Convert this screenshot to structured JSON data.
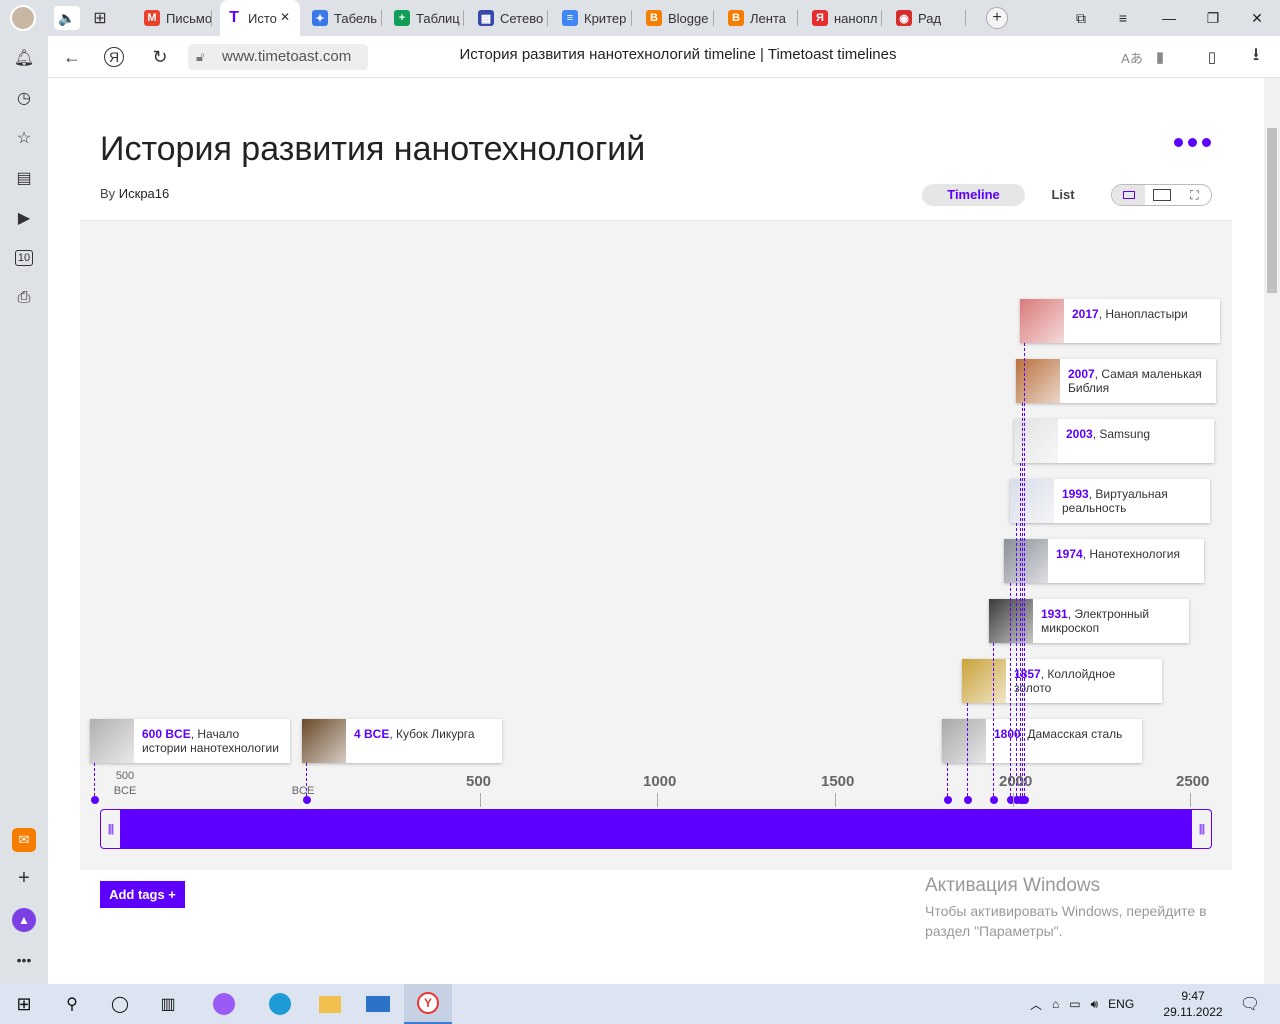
{
  "browser": {
    "tabs": [
      {
        "label": "Письмо",
        "color": "#e8412c",
        "glyph": "M"
      },
      {
        "label": "Исто",
        "color": "#5e00ff",
        "glyph": "T",
        "active": true
      },
      {
        "label": "Табель",
        "color": "#3b78e7",
        "glyph": "✦"
      },
      {
        "label": "Таблиц",
        "color": "#0f9d58",
        "glyph": "+"
      },
      {
        "label": "Сетево",
        "color": "#3949ab",
        "glyph": "▦"
      },
      {
        "label": "Критер",
        "color": "#4285f4",
        "glyph": "≡"
      },
      {
        "label": "Blogge",
        "color": "#f57d00",
        "glyph": "B"
      },
      {
        "label": "Лента",
        "color": "#f57d00",
        "glyph": "B"
      },
      {
        "label": "нанопл",
        "color": "#e62e2e",
        "glyph": "Я"
      },
      {
        "label": "Рад",
        "color": "#d32f2f",
        "glyph": "◉"
      }
    ],
    "url": "www.timetoast.com",
    "page_title": "История развития нанотехнологий timeline | Timetoast timelines",
    "sidebar_counter": "10"
  },
  "timeline": {
    "title": "История развития нанотехнологий",
    "author_prefix": "By ",
    "author": "Искра16",
    "view_timeline": "Timeline",
    "view_list": "List",
    "add_tags": "Add tags +",
    "events": [
      {
        "year": "600 BCE",
        "text": ", Начало истории нанотехнологии",
        "thumb": "#b0b0b0"
      },
      {
        "year": "4 BCE",
        "text": ", Кубок Ликурга",
        "thumb": "#6b4a2a"
      },
      {
        "year": "1800",
        "text": ", Дамасская сталь",
        "thumb": "#a8a8a8"
      },
      {
        "year": "1857",
        "text": ", Коллойдное золото",
        "thumb": "#c9a23a"
      },
      {
        "year": "1931",
        "text": ", Электронный микроскоп",
        "thumb": "#3a3a3a"
      },
      {
        "year": "1974",
        "text": ", Нанотехнология",
        "thumb": "#8a8f96"
      },
      {
        "year": "1993",
        "text": ", Виртуальная реальность",
        "thumb": "#d9dde8"
      },
      {
        "year": "2003",
        "text": ", Samsung",
        "thumb": "#e2e2e2"
      },
      {
        "year": "2007",
        "text": ", Самая маленькая Библия",
        "thumb": "#b8703d"
      },
      {
        "year": "2017",
        "text": ", Нанопластыри",
        "thumb": "#d97a7a"
      }
    ],
    "axis": {
      "labels": [
        "500",
        "1000",
        "1500",
        "2000",
        "2500"
      ],
      "bce_labels": [
        {
          "a": "500",
          "b": "BCE"
        },
        {
          "a": "",
          "b": "BCE"
        }
      ]
    },
    "accent_color": "#5e00ff"
  },
  "windows_activation": {
    "heading": "Активация Windows",
    "line1": "Чтобы активировать Windows, перейдите в",
    "line2": "раздел \"Параметры\"."
  },
  "taskbar": {
    "lang": "ENG",
    "time": "9:47",
    "date": "29.11.2022"
  }
}
